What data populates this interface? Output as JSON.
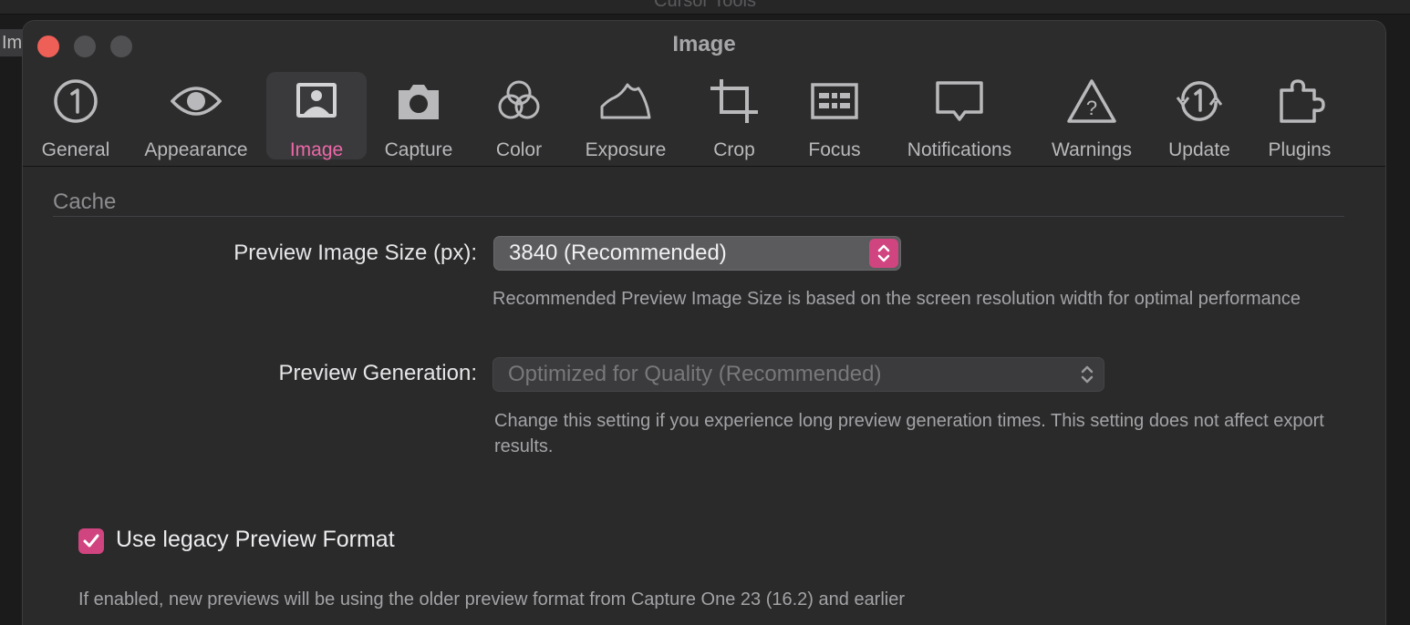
{
  "background_app": {
    "title": "Cursor Tools",
    "tab_fragment": "Im"
  },
  "window": {
    "title": "Image"
  },
  "tabs": [
    {
      "label": "General",
      "icon": "general-icon",
      "active": false
    },
    {
      "label": "Appearance",
      "icon": "eye-icon",
      "active": false
    },
    {
      "label": "Image",
      "icon": "image-icon",
      "active": true
    },
    {
      "label": "Capture",
      "icon": "camera-icon",
      "active": false
    },
    {
      "label": "Color",
      "icon": "color-circles-icon",
      "active": false
    },
    {
      "label": "Exposure",
      "icon": "histogram-icon",
      "active": false
    },
    {
      "label": "Crop",
      "icon": "crop-icon",
      "active": false
    },
    {
      "label": "Focus",
      "icon": "focus-grid-icon",
      "active": false
    },
    {
      "label": "Notifications",
      "icon": "speech-bubble-icon",
      "active": false
    },
    {
      "label": "Warnings",
      "icon": "warning-triangle-icon",
      "active": false
    },
    {
      "label": "Update",
      "icon": "update-icon",
      "active": false
    },
    {
      "label": "Plugins",
      "icon": "puzzle-icon",
      "active": false
    }
  ],
  "cache": {
    "section_title": "Cache",
    "preview_size": {
      "label": "Preview Image Size (px):",
      "value": "3840 (Recommended)",
      "help": "Recommended Preview Image Size is based on the screen resolution width for optimal performance"
    },
    "preview_generation": {
      "label": "Preview Generation:",
      "value": "Optimized for Quality (Recommended)",
      "enabled": false,
      "help": "Change this setting if you experience long preview generation times. This setting does not affect export results."
    },
    "legacy_format": {
      "label": "Use legacy Preview Format",
      "checked": true,
      "help": "If enabled, new previews will be using the older preview format from Capture One 23 (16.2) and earlier"
    }
  },
  "colors": {
    "accent": "#d0457f",
    "accent_text": "#ec68a8",
    "close_button": "#ee5f57",
    "window_bg": "#2a2a2b"
  }
}
